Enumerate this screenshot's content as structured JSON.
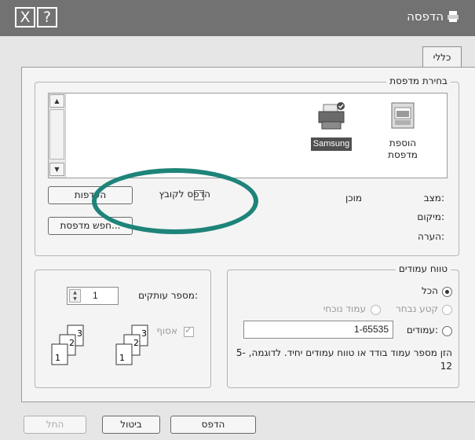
{
  "window": {
    "title": "הדפסה",
    "close_glyph": "X",
    "help_glyph": "?"
  },
  "tabs": [
    {
      "label": "כללי"
    }
  ],
  "printer_group": {
    "label": "בחירת מדפסת",
    "printers": [
      {
        "label_line1": "הוספת",
        "label_line2": "מדפסת"
      },
      {
        "label": "Samsung"
      }
    ],
    "print_to_file_label": "הדפס לקובץ",
    "preferences_button": "העדפות",
    "find_printer_button": "חפש מדפסת...",
    "status_label": "מצב:",
    "status_value": "מוכן",
    "location_label": "מיקום:",
    "comment_label": "הערה:"
  },
  "page_range": {
    "label": "טווח עמודים",
    "all_label": "הכל",
    "selection_label": "קטע נבחר",
    "current_page_label": "עמוד נוכחי",
    "pages_label": "עמודים:",
    "pages_value": "1-65535",
    "hint": "הזן מספר עמוד בודד או טווח עמודים יחיד. לדוגמה, 5-12"
  },
  "copies": {
    "label": "מספר עותקים:",
    "value": "1",
    "collate_label": "אסוף",
    "collate_numbers": [
      "1",
      "2",
      "3"
    ]
  },
  "buttons": {
    "print": "הדפס",
    "cancel": "ביטול",
    "apply": "החל"
  },
  "colors": {
    "highlight_oval": "#1e847a",
    "titlebar": "#727272"
  }
}
